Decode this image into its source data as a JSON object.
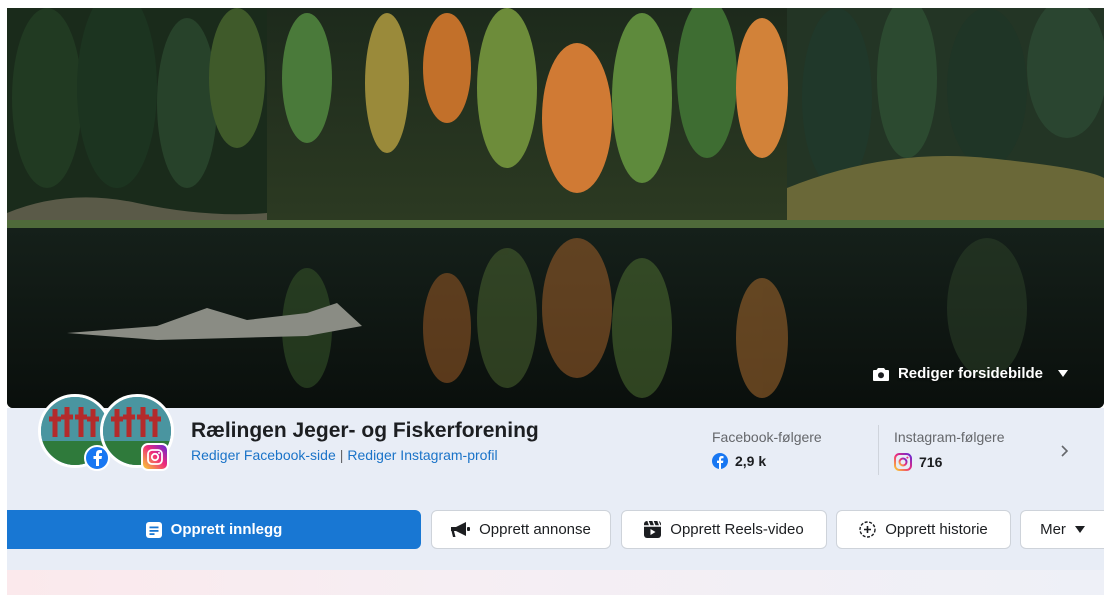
{
  "cover": {
    "edit_label": "Rediger forsidebilde"
  },
  "profile": {
    "name": "Rælingen Jeger- og Fiskerforening",
    "edit_facebook_link": "Rediger Facebook-side",
    "link_separator": "|",
    "edit_instagram_link": "Rediger Instagram-profil"
  },
  "stats": {
    "facebook": {
      "label": "Facebook-følgere",
      "value": "2,9 k"
    },
    "instagram": {
      "label": "Instagram-følgere",
      "value": "716"
    }
  },
  "actions": {
    "create_post": "Opprett innlegg",
    "create_ad": "Opprett annonse",
    "create_reels": "Opprett Reels-video",
    "create_story": "Opprett historie",
    "more": "Mer"
  },
  "colors": {
    "primary": "#1877d3",
    "link": "#1a73c8",
    "facebook": "#1877f2"
  },
  "icons": [
    "camera-icon",
    "chevron-down-icon",
    "facebook-icon",
    "instagram-icon",
    "chevron-right-icon",
    "post-icon",
    "megaphone-icon",
    "reels-icon",
    "story-icon"
  ]
}
